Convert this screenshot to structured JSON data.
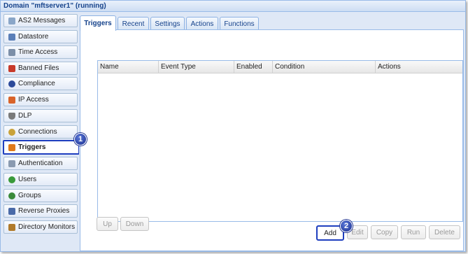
{
  "window": {
    "title": "Domain \"mftserver1\" (running)"
  },
  "sidebar": {
    "items": [
      {
        "label": "AS2 Messages",
        "icon": "envelope-icon",
        "color": "#8aa6c8"
      },
      {
        "label": "Datastore",
        "icon": "database-icon",
        "color": "#5b7fb8"
      },
      {
        "label": "Time Access",
        "icon": "clock-icon",
        "color": "#7c8fa8"
      },
      {
        "label": "Banned Files",
        "icon": "banned-file-icon",
        "color": "#c83a2a"
      },
      {
        "label": "Compliance",
        "icon": "person-icon",
        "color": "#2c4a9a"
      },
      {
        "label": "IP Access",
        "icon": "firewall-icon",
        "color": "#d9642a"
      },
      {
        "label": "DLP",
        "icon": "shield-icon",
        "color": "#7a7a7a"
      },
      {
        "label": "Connections",
        "icon": "connections-icon",
        "color": "#c9a23a"
      },
      {
        "label": "Triggers",
        "icon": "trigger-icon",
        "color": "#e07a1a"
      },
      {
        "label": "Authentication",
        "icon": "authentication-icon",
        "color": "#8a9ab0"
      },
      {
        "label": "Users",
        "icon": "user-icon",
        "color": "#3a9a3a"
      },
      {
        "label": "Groups",
        "icon": "group-icon",
        "color": "#3a8a3a"
      },
      {
        "label": "Reverse Proxies",
        "icon": "proxy-icon",
        "color": "#4a6aa8"
      },
      {
        "label": "Directory Monitors",
        "icon": "directory-monitor-icon",
        "color": "#b07a2a"
      }
    ]
  },
  "tabs": [
    "Triggers",
    "Recent",
    "Settings",
    "Actions",
    "Functions"
  ],
  "grid": {
    "columns": [
      "Name",
      "Event Type",
      "Enabled",
      "Condition",
      "Actions"
    ]
  },
  "buttons": {
    "up": "Up",
    "down": "Down",
    "add": "Add",
    "edit": "Edit",
    "copy": "Copy",
    "run": "Run",
    "delete": "Delete"
  },
  "callouts": {
    "one": "1",
    "two": "2"
  },
  "colors": {
    "accent": "#1f3fbf",
    "header_text": "#15428b",
    "panel_bg": "#dfe8f6"
  }
}
